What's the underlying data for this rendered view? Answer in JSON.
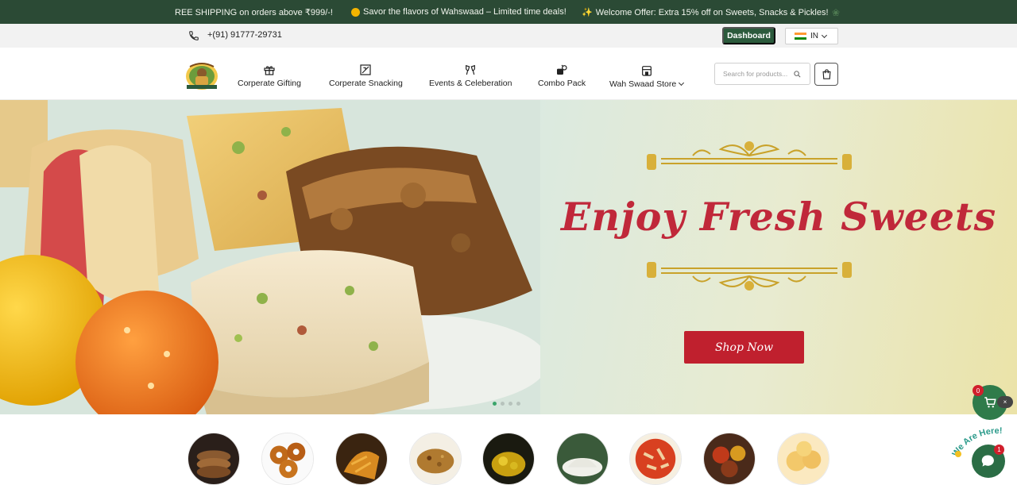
{
  "announcement": {
    "messages": [
      "REE SHIPPING on orders above ₹999/-!",
      "Savor the flavors of Wahswaad – Limited time deals!",
      "Welcome Offer: Extra 15% off on Sweets, Snacks & Pickles!"
    ]
  },
  "contact": {
    "phone": "+(91) 91777-29731",
    "dashboard_label": "Dashboard",
    "region_code": "IN"
  },
  "header": {
    "logo_text": "Wah Swaad",
    "nav": [
      {
        "label": "Corperate Gifting",
        "icon": "gift-icon"
      },
      {
        "label": "Corperate Snacking",
        "icon": "snack-box-icon"
      },
      {
        "label": "Events & Celeberation",
        "icon": "cheers-icon"
      },
      {
        "label": "Combo Pack",
        "icon": "combo-icon"
      },
      {
        "label": "Wah Swaad Store",
        "icon": "store-icon"
      }
    ],
    "search_placeholder": "Search for products...",
    "cart_icon": "shopping-bag-icon"
  },
  "hero": {
    "title": "Enjoy Fresh Sweets",
    "cta_label": "Shop Now",
    "slide_count": 4,
    "active_slide": 1
  },
  "categories": {
    "count": 9,
    "items": [
      "cookies",
      "vada",
      "fried-snacks",
      "spicy-mix",
      "pickle",
      "rice-flour",
      "pasta",
      "spices",
      "rasgulla"
    ]
  },
  "widgets": {
    "cart_count": "0",
    "close_symbol": "×",
    "chat_label": "We Are Here!",
    "chat_badge": "1"
  },
  "colors": {
    "brand_green": "#2b4a35",
    "accent_red": "#c0283a",
    "dashboard_green": "#2b5a3c"
  }
}
